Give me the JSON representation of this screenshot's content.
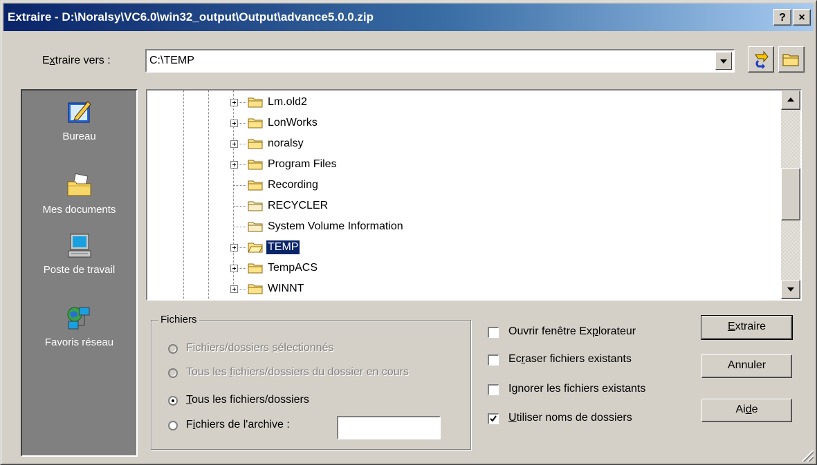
{
  "window": {
    "title": "Extraire - D:\\Noralsy\\VC6.0\\win32_output\\Output\\advance5.0.0.zip",
    "help_button": "?",
    "close_button": "×"
  },
  "extract_to": {
    "label_pre": "E",
    "label_u": "x",
    "label_post": "traire vers :",
    "value": "C:\\TEMP"
  },
  "places": [
    {
      "label": "Bureau",
      "icon": "desktop-icon"
    },
    {
      "label": "Mes documents",
      "icon": "my-documents-icon"
    },
    {
      "label": "Poste de travail",
      "icon": "my-computer-icon"
    },
    {
      "label": "Favoris réseau",
      "icon": "network-places-icon"
    }
  ],
  "tree": {
    "items": [
      {
        "name": "Lm.old2",
        "expandable": true,
        "selected": false
      },
      {
        "name": "LonWorks",
        "expandable": true,
        "selected": false
      },
      {
        "name": "noralsy",
        "expandable": true,
        "selected": false
      },
      {
        "name": "Program Files",
        "expandable": true,
        "selected": false
      },
      {
        "name": "Recording",
        "expandable": false,
        "selected": false
      },
      {
        "name": "RECYCLER",
        "expandable": false,
        "selected": false
      },
      {
        "name": "System Volume Information",
        "expandable": false,
        "selected": false
      },
      {
        "name": "TEMP",
        "expandable": true,
        "selected": true
      },
      {
        "name": "TempACS",
        "expandable": true,
        "selected": false
      },
      {
        "name": "WINNT",
        "expandable": true,
        "selected": false
      }
    ]
  },
  "files_group": {
    "title": "Fichiers",
    "options": [
      {
        "pre": "Fichiers/dossiers ",
        "u": "s",
        "post": "électionnés",
        "enabled": false,
        "checked": false
      },
      {
        "pre": "Tous les ",
        "u": "f",
        "post": "ichiers/dossiers du dossier en cours",
        "enabled": false,
        "checked": false
      },
      {
        "pre": "",
        "u": "T",
        "post": "ous les fichiers/dossiers",
        "enabled": true,
        "checked": true
      },
      {
        "pre": "F",
        "u": "i",
        "post": "chiers de l'archive :",
        "enabled": true,
        "checked": false
      }
    ],
    "archive_value": ""
  },
  "checkboxes": [
    {
      "pre": "Ouvrir fenêtre Ex",
      "u": "p",
      "post": "lorateur",
      "checked": false
    },
    {
      "pre": "Ec",
      "u": "r",
      "post": "aser fichiers existants",
      "checked": false
    },
    {
      "pre": "I",
      "u": "g",
      "post": "norer les fichiers existants",
      "checked": false
    },
    {
      "pre": "",
      "u": "U",
      "post": "tiliser noms de dossiers",
      "checked": true
    }
  ],
  "buttons": {
    "extract": {
      "pre": "",
      "u": "E",
      "post": "xtraire"
    },
    "cancel": {
      "pre": "Annuler",
      "u": "",
      "post": ""
    },
    "help": {
      "pre": "Ai",
      "u": "d",
      "post": "e"
    }
  },
  "colors": {
    "title_start": "#0a246a",
    "title_end": "#a6caf0",
    "face": "#d4d0c8",
    "selection": "#0a246a"
  }
}
